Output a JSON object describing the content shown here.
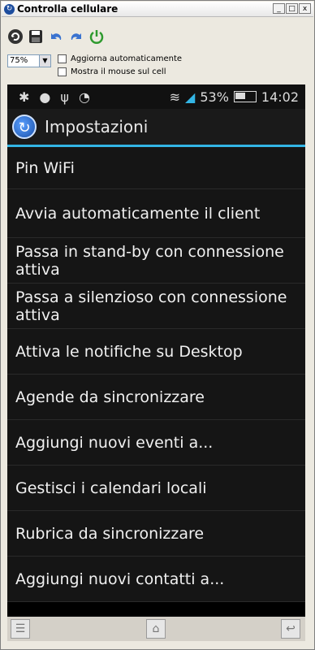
{
  "window": {
    "title": "Controlla cellulare",
    "buttons": {
      "minimize": "_",
      "maximize": "□",
      "close": "x"
    }
  },
  "toolbar": {
    "icons": [
      "refresh-icon",
      "save-icon",
      "undo-icon",
      "redo-icon",
      "power-icon"
    ]
  },
  "zoom": {
    "value": "75%"
  },
  "options": {
    "auto_update": "Aggiorna automaticamente",
    "show_mouse": "Mostra il mouse sul cell"
  },
  "phone": {
    "status": {
      "battery": "53%",
      "time": "14:02"
    },
    "actionbar": {
      "title": "Impostazioni"
    },
    "items": [
      "Pin WiFi",
      "Avvia automaticamente il client",
      "Passa in stand-by con connessione attiva",
      "Passa a silenzioso con connessione attiva",
      "Attiva le notifiche su Desktop",
      "Agende da sincronizzare",
      "Aggiungi nuovi eventi a...",
      "Gestisci i calendari locali",
      "Rubrica da sincronizzare",
      "Aggiungi nuovi contatti a..."
    ]
  },
  "colors": {
    "accent": "#33b5e5",
    "phone_bg": "#151515"
  }
}
